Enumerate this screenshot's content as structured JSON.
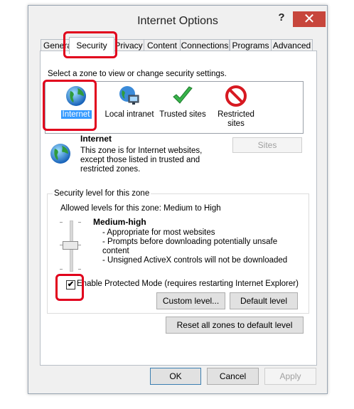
{
  "window": {
    "title": "Internet Options",
    "help_label": "?",
    "close_label": "✕"
  },
  "tabs": [
    {
      "label": "General"
    },
    {
      "label": "Security",
      "active": true
    },
    {
      "label": "Privacy"
    },
    {
      "label": "Content"
    },
    {
      "label": "Connections"
    },
    {
      "label": "Programs"
    },
    {
      "label": "Advanced"
    }
  ],
  "security": {
    "zone_prompt": "Select a zone to view or change security settings.",
    "zones": [
      {
        "label": "Internet",
        "icon": "globe-icon",
        "selected": true
      },
      {
        "label": "Local intranet",
        "icon": "intranet-icon"
      },
      {
        "label": "Trusted sites",
        "icon": "checkmark-icon"
      },
      {
        "label": "Restricted sites",
        "icon": "restricted-icon"
      }
    ],
    "selected_zone": {
      "name": "Internet",
      "description": "This zone is for Internet websites, except those listed in trusted and restricted zones.",
      "sites_button": "Sites"
    },
    "level_group": {
      "legend": "Security level for this zone",
      "allowed_levels": "Allowed levels for this zone: Medium to High",
      "level_name": "Medium-high",
      "bullets": [
        "- Appropriate for most websites",
        "- Prompts before downloading potentially unsafe",
        "content",
        "- Unsigned ActiveX controls will not be downloaded"
      ],
      "protected_mode_label": "Enable Protected Mode (requires restarting Internet Explorer)",
      "protected_mode_checked": true,
      "custom_level_button": "Custom level...",
      "default_level_button": "Default level"
    },
    "reset_button": "Reset all zones to default level"
  },
  "footer": {
    "ok": "OK",
    "cancel": "Cancel",
    "apply": "Apply"
  },
  "colors": {
    "highlight": "#e1001c",
    "selection": "#3399ff",
    "close_button": "#c7463c"
  }
}
